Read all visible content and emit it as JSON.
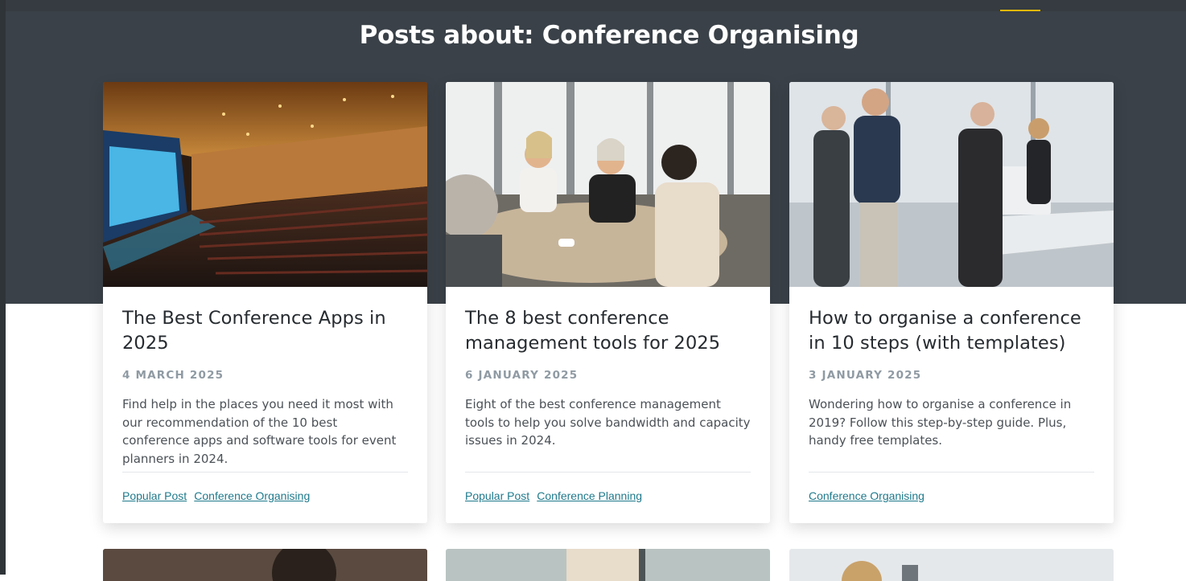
{
  "page": {
    "title_lead": "Posts about:",
    "title_topic": "Conference Organising"
  },
  "colors": {
    "header_bg": "#3a4148",
    "accent_underline": "#e6b800",
    "tag_link": "#1f7a8c",
    "date_text": "#8f9aa3"
  },
  "cards": [
    {
      "image_alt": "conference auditorium",
      "title": "The Best Conference Apps in 2025",
      "date": "4 MARCH 2025",
      "excerpt": "Find help in the places you need it most with our recommendation of the 10 best conference apps and software tools for event planners in 2024.",
      "tags": [
        "Popular Post",
        "Conference Organising"
      ]
    },
    {
      "image_alt": "business meeting around a table",
      "title": "The 8 best conference management tools for 2025",
      "date": "6 JANUARY 2025",
      "excerpt": "Eight of the best conference management tools to help you solve bandwidth and capacity issues in 2024.",
      "tags": [
        "Popular Post",
        "Conference Planning"
      ]
    },
    {
      "image_alt": "people talking at a conference",
      "title": "How to organise a conference in 10 steps (with templates)",
      "date": "3 JANUARY 2025",
      "excerpt": "Wondering how to organise a conference in 2019? Follow this step-by-step guide. Plus, handy free templates.",
      "tags": [
        "Conference Organising"
      ]
    }
  ]
}
